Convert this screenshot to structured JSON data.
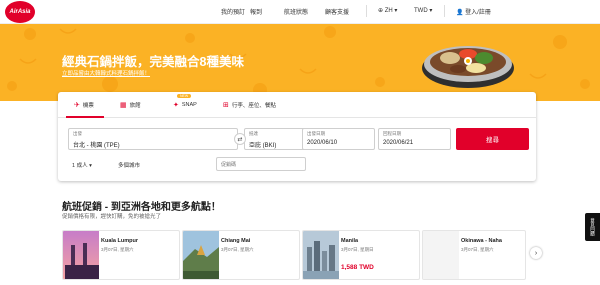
{
  "nav": {
    "logo_text": "AirAsia",
    "my_bookings": "我的預訂",
    "checkin": "報到",
    "flight_status": "航班狀態",
    "support": "顧客支援",
    "language": "ZH",
    "currency": "TWD",
    "login": "登入/註冊"
  },
  "hero": {
    "title": "經典石鍋拌飯，完美融合8種美味",
    "subtitle": "立即品嘗由大韓韓式料理石鍋拌飯！"
  },
  "search": {
    "tabs": [
      {
        "label": "機票",
        "icon": "plane-icon"
      },
      {
        "label": "旅館",
        "icon": "hotel-icon"
      },
      {
        "label": "SNAP",
        "icon": "snap-icon"
      },
      {
        "label": "行李、座位、餐點",
        "icon": "bag-icon"
      }
    ],
    "badge": "NEW",
    "from_label": "出發",
    "from_value": "台北 - 桃園 (TPE)",
    "to_label": "抵達",
    "to_value": "亞庇 (BKI)",
    "depart_label": "出發日期",
    "depart_value": "2020/06/10",
    "return_label": "回程日期",
    "return_value": "2020/06/21",
    "search_button": "搜尋",
    "passengers": "1 成人",
    "multi_city": "多個城市",
    "promo_placeholder": "促銷碼"
  },
  "promo": {
    "title": "航班促銷 - 到亞洲各地和更多航點！",
    "subtitle": "促銷價格有限，趕快訂購，免的被搶光了",
    "cards": [
      {
        "city": "Kuala Lumpur",
        "date": "3月07日, 星期六",
        "price": ""
      },
      {
        "city": "Chiang Mai",
        "date": "3月07日, 星期六",
        "price": ""
      },
      {
        "city": "Manila",
        "date": "3月07日, 星期日",
        "price": "1,588 TWD"
      },
      {
        "city": "Okinawa - Naha",
        "date": "3月07日, 星期六",
        "price": ""
      }
    ],
    "next_arrow": "›"
  },
  "side_tab": "意見回饋",
  "colors": {
    "brand_red": "#e1002a",
    "hero_yellow": "#fbb225"
  }
}
